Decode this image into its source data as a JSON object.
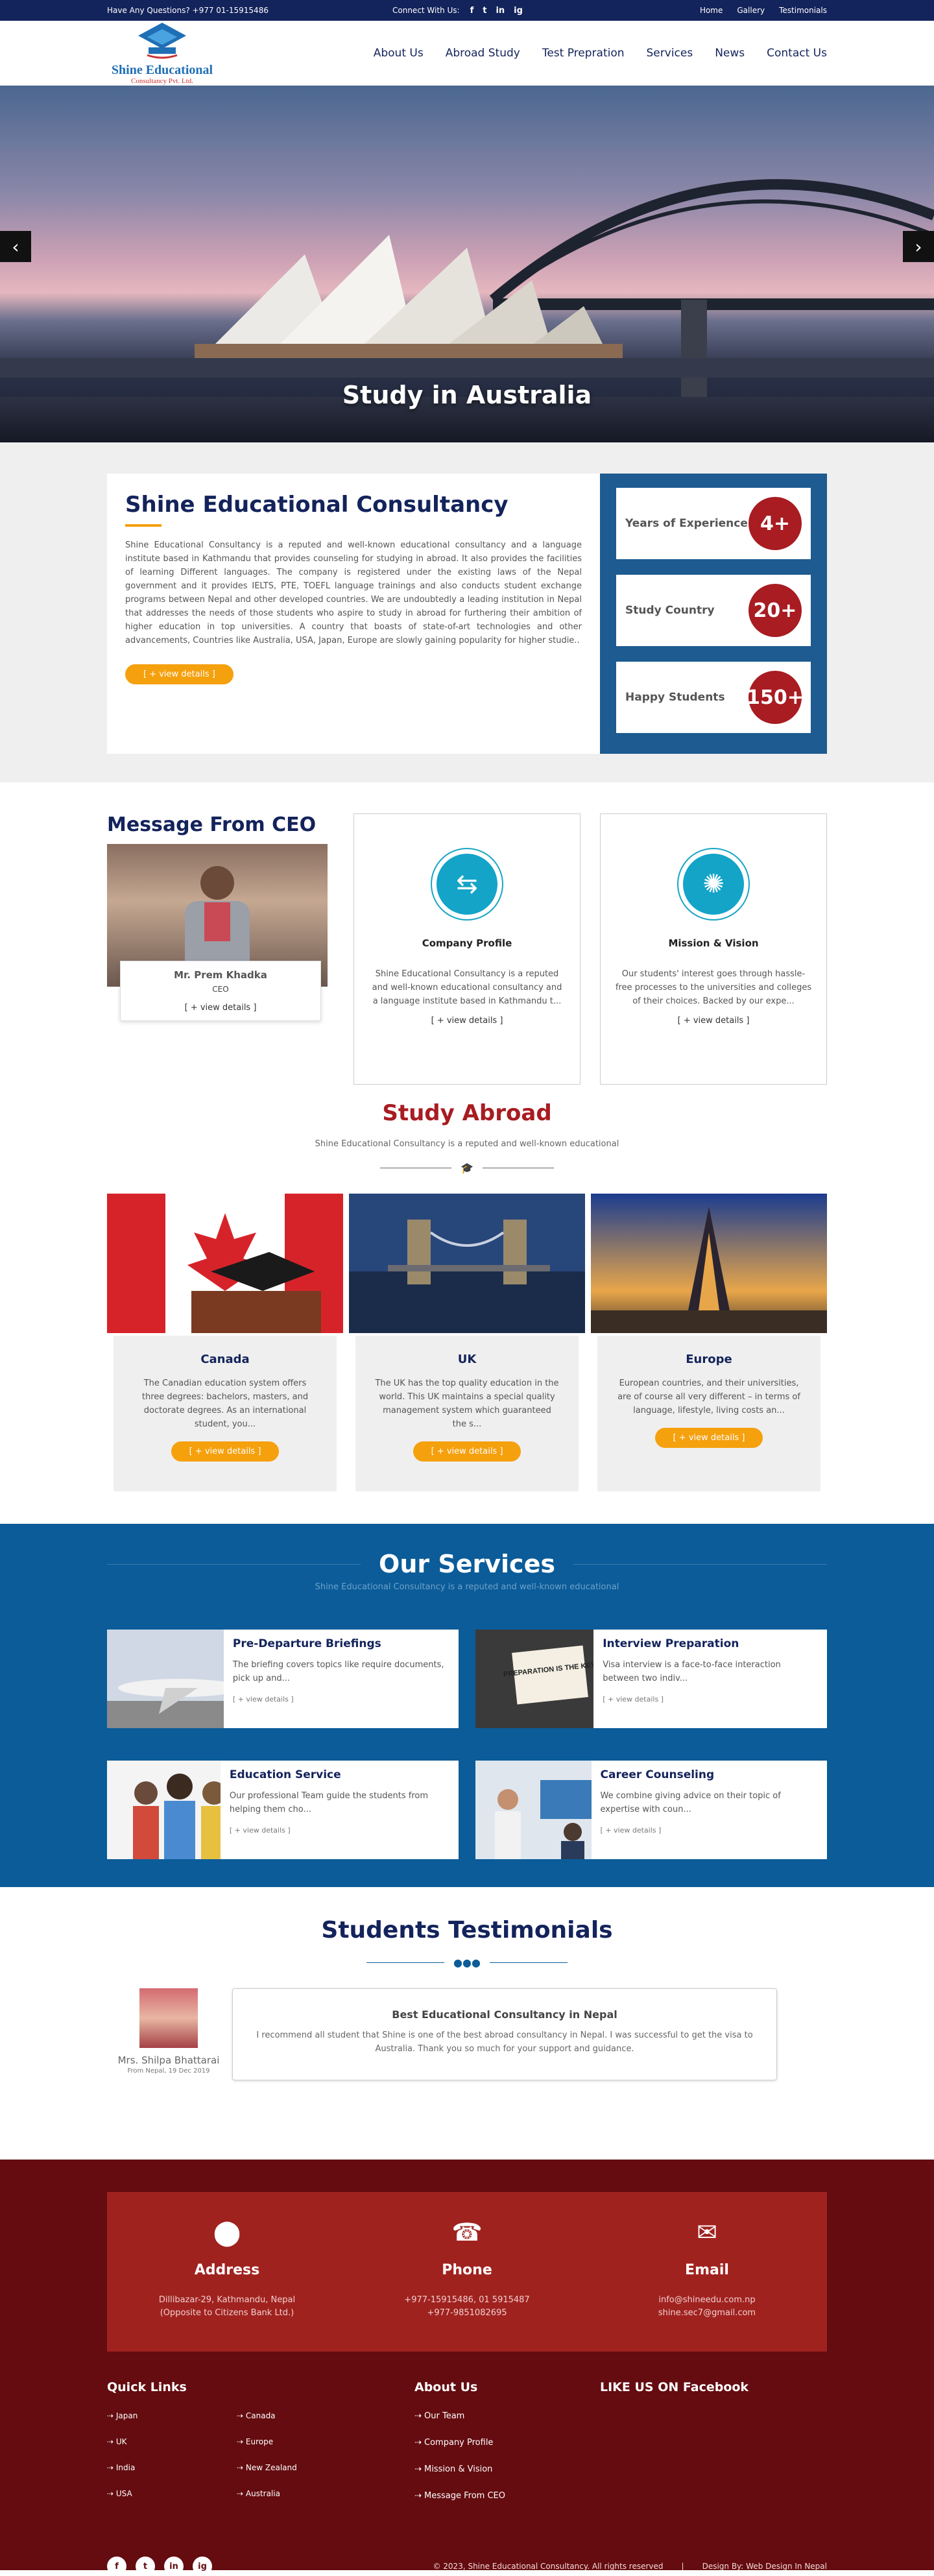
{
  "topbar": {
    "question": "Have Any Questions? +977 01-15915486",
    "connect": "Connect With Us:",
    "social": [
      "f",
      "t",
      "in",
      "ig"
    ],
    "links": [
      "Home",
      "Gallery",
      "Testimonials"
    ]
  },
  "header": {
    "logo_title": "Shine Educational",
    "logo_sub": "Consultancy Pvt. Ltd.",
    "nav": [
      "About Us",
      "Abroad Study",
      "Test Prepration",
      "Services",
      "News",
      "Contact Us"
    ]
  },
  "hero": {
    "caption": "Study in Australia",
    "prev": "‹",
    "next": "›"
  },
  "about": {
    "title": "Shine Educational Consultancy",
    "text": "Shine Educational Consultancy is a reputed and well-known educational consultancy and a language institute based in Kathmandu that provides counseling for studying in abroad. It also provides the facilities of learning Different languages. The company is registered under the existing laws of the Nepal government and it provides IELTS, PTE, TOEFL language trainings and also conducts student exchange programs between Nepal and other developed countries. We are undoubtedly a leading institution in Nepal that addresses the needs of those students who aspire to study in abroad for furthering their ambition of higher education in top universities. A country that boasts of state-of-art technologies and other advancements, Countries like Australia, USA, Japan, Europe are slowly gaining popularity for higher studie..",
    "button": "[ + view details ]",
    "stats": [
      {
        "label": "Years of Experience",
        "value": "4+"
      },
      {
        "label": "Study Country",
        "value": "20+"
      },
      {
        "label": "Happy Students",
        "value": "150+"
      }
    ]
  },
  "ceo": {
    "heading": "Message From CEO",
    "name": "Mr. Prem Khadka",
    "title": "CEO",
    "link": "[ + view details ]"
  },
  "boxes": [
    {
      "title": "Company Profile",
      "text": "Shine Educational Consultancy is a reputed and well-known educational consultancy and a language institute based in Kathmandu t...",
      "link": "[ + view details ]"
    },
    {
      "title": "Mission & Vision",
      "text": "Our students' interest goes through hassle-free processes to the universities and colleges of their choices. Backed by our expe...",
      "link": "[ + view details ]"
    }
  ],
  "study": {
    "title": "Study Abroad",
    "subtitle": "Shine Educational Consultancy is a reputed and well-known educational",
    "cards": [
      {
        "title": "Canada",
        "text": "The Canadian education system offers three degrees: bachelors, masters, and doctorate degrees. As an international student, you...",
        "link": "[ + view details ]"
      },
      {
        "title": "UK",
        "text": "The UK has the top quality education in the world. This UK maintains a special quality management system which guaranteed the s...",
        "link": "[ + view details ]"
      },
      {
        "title": "Europe",
        "text": "European countries, and their universities, are of course all very different – in terms of language, lifestyle, living costs an...",
        "link": "[ + view details ]"
      }
    ]
  },
  "services": {
    "title": "Our Services",
    "subtitle": "Shine Educational Consultancy is a reputed and well-known educational",
    "items": [
      {
        "title": "Pre-Departure Briefings",
        "text": "The briefing covers topics like require documents, pick up and...",
        "link": "[ + view details ]"
      },
      {
        "title": "Interview Preparation",
        "text": "Visa interview is a face-to-face interaction between two indiv...",
        "link": "[ + view details ]"
      },
      {
        "title": "Education Service",
        "text": "Our professional Team guide the students from helping them cho...",
        "link": "[ + view details ]"
      },
      {
        "title": "Career Counseling",
        "text": "We combine giving advice on their topic of expertise with coun...",
        "link": "[ + view details ]"
      }
    ],
    "sign_text": "PREPARATION IS THE KEY"
  },
  "testimonials": {
    "title": "Students Testimonials",
    "name": "Mrs. Shilpa Bhattarai",
    "date": "From Nepal, 19 Dec 2019",
    "quote_title": "Best Educational Consultancy in Nepal",
    "quote": "I recommend all student that Shine is one of the best abroad consultancy in Nepal. I was successful to get the visa to Australia. Thank you so much for your support and guidance."
  },
  "footer": {
    "contact": [
      {
        "title": "Address",
        "lines": [
          "Dillibazar-29, Kathmandu, Nepal",
          "(Opposite to Citizens Bank Ltd.)"
        ]
      },
      {
        "title": "Phone",
        "lines": [
          "+977-15915486, 01 5915487",
          "+977-9851082695"
        ]
      },
      {
        "title": "Email",
        "lines": [
          "info@shineedu.com.np",
          "shine.sec7@gmail.com"
        ]
      }
    ],
    "quick_title": "Quick Links",
    "quick": [
      "Japan",
      "Canada",
      "UK",
      "Europe",
      "India",
      "New Zealand",
      "USA",
      "Australia"
    ],
    "about_title": "About Us",
    "about": [
      "Our Team",
      "Company Profile",
      "Mission & Vision",
      "Message From CEO"
    ],
    "fb_title": "LIKE US ON Facebook",
    "copyright": "© 2023, Shine Educational Consultancy. All rights reserved",
    "sep": "|",
    "design": "Design By: Web Design In Nepal",
    "social": [
      "f",
      "t",
      "in",
      "ig"
    ]
  },
  "colors": {
    "navy": "#13235b",
    "blue": "#0b5c99",
    "red": "#a81c22",
    "orange": "#f5a00d",
    "footer": "#640c10"
  }
}
